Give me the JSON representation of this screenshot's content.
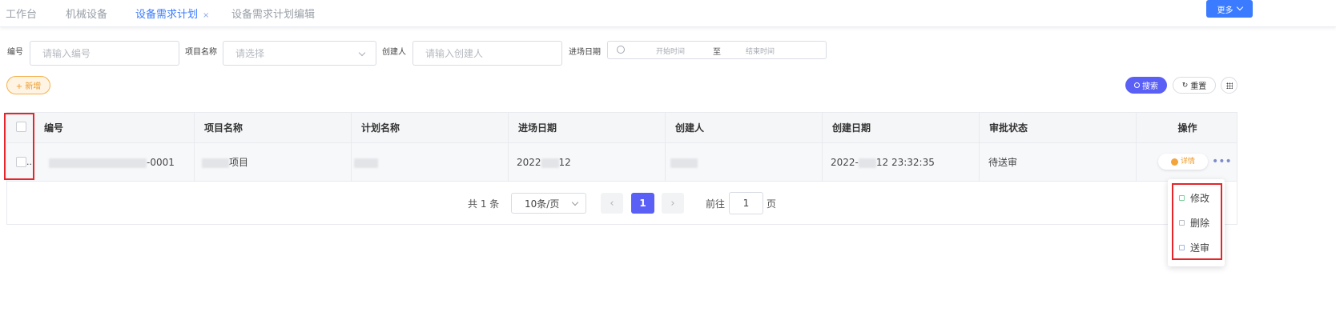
{
  "tabs": [
    {
      "label": "工作台"
    },
    {
      "label": "机械设备"
    },
    {
      "label": "设备需求计划",
      "close": "×"
    },
    {
      "label": "设备需求计划编辑"
    }
  ],
  "more_button": {
    "label": "更多"
  },
  "filters": {
    "code": {
      "label": "编号",
      "placeholder": "请输入编号"
    },
    "project": {
      "label": "项目名称",
      "placeholder": "请选择"
    },
    "creator": {
      "label": "创建人",
      "placeholder": "请输入创建人"
    },
    "date": {
      "label": "进场日期",
      "start_placeholder": "开始时间",
      "separator": "至",
      "end_placeholder": "结束时间"
    }
  },
  "toolbar": {
    "add_label": "+ 新增",
    "search_label": "搜索",
    "reset_label": "重置"
  },
  "table": {
    "columns": [
      "编号",
      "项目名称",
      "计划名称",
      "进场日期",
      "创建人",
      "创建日期",
      "审批状态",
      "操作"
    ],
    "rows": [
      {
        "code_suffix": "-0001",
        "project_suffix": "项目",
        "date_prefix": "2022",
        "date_suffix": "12",
        "created_prefix": "2022-",
        "created_suffix": "12 23:32:35",
        "status": "待送审",
        "detail_label": "详情",
        "more_label": "•••",
        "checkbox_overflow": "..."
      }
    ]
  },
  "pagination": {
    "total": "共 1 条",
    "page_size": "10条/页",
    "prev": "‹",
    "current": "1",
    "next": "›",
    "goto_label": "前往",
    "goto_value": "1",
    "page_unit": "页"
  },
  "row_menu": {
    "items": [
      {
        "label": "修改",
        "icon": "edit-icon"
      },
      {
        "label": "删除",
        "icon": "trash-icon"
      },
      {
        "label": "送审",
        "icon": "send-icon"
      }
    ]
  },
  "colors": {
    "accent": "#3a7bff",
    "primary_button": "#5a5ff5",
    "add_button": "#ee9a2a",
    "highlight": "#e4262a"
  }
}
